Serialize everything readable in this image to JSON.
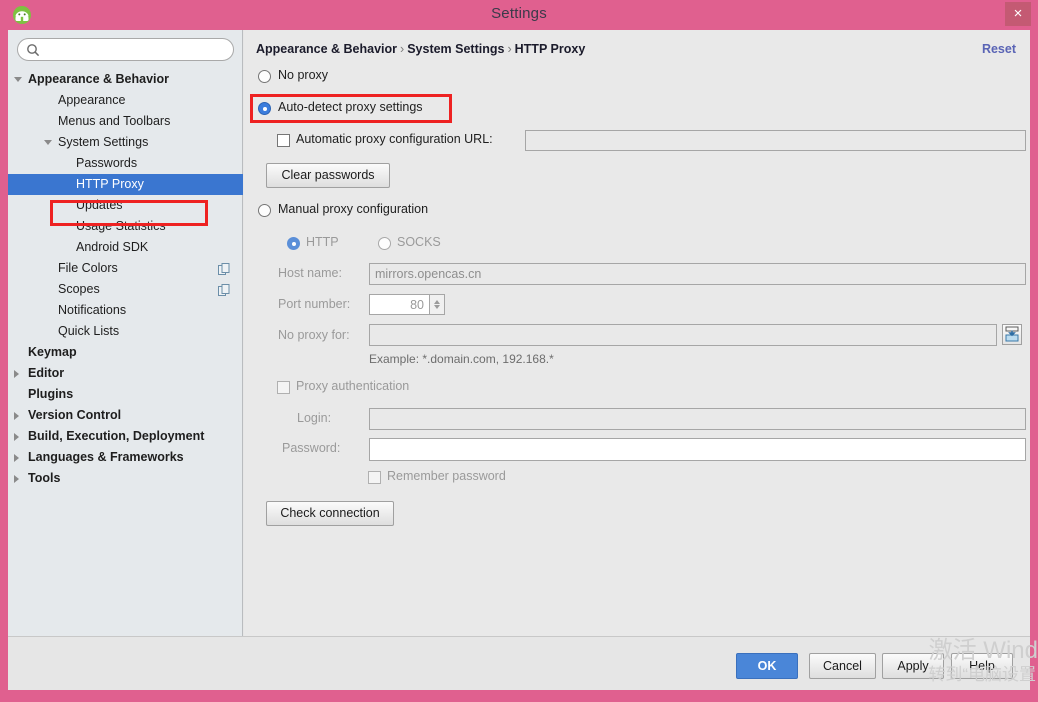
{
  "window": {
    "title": "Settings",
    "app_icon": "android-studio-icon",
    "close_label": "×",
    "accent_pink": "#e0608f",
    "selection_blue": "#3a76d0",
    "annotation_red": "#ee2222"
  },
  "search": {
    "placeholder": "",
    "value": "",
    "icon": "search-icon"
  },
  "sidebar": {
    "items": [
      {
        "label": "Appearance & Behavior",
        "indent": 20,
        "bold": true,
        "twisty": "open",
        "selected": false,
        "icon": null
      },
      {
        "label": "Appearance",
        "indent": 50,
        "bold": false,
        "twisty": null,
        "selected": false,
        "icon": null
      },
      {
        "label": "Menus and Toolbars",
        "indent": 50,
        "bold": false,
        "twisty": null,
        "selected": false,
        "icon": null
      },
      {
        "label": "System Settings",
        "indent": 50,
        "bold": false,
        "twisty": "open",
        "selected": false,
        "icon": null
      },
      {
        "label": "Passwords",
        "indent": 68,
        "bold": false,
        "twisty": null,
        "selected": false,
        "icon": null
      },
      {
        "label": "HTTP Proxy",
        "indent": 68,
        "bold": false,
        "twisty": null,
        "selected": true,
        "icon": null
      },
      {
        "label": "Updates",
        "indent": 68,
        "bold": false,
        "twisty": null,
        "selected": false,
        "icon": null
      },
      {
        "label": "Usage Statistics",
        "indent": 68,
        "bold": false,
        "twisty": null,
        "selected": false,
        "icon": null
      },
      {
        "label": "Android SDK",
        "indent": 68,
        "bold": false,
        "twisty": null,
        "selected": false,
        "icon": null
      },
      {
        "label": "File Colors",
        "indent": 50,
        "bold": false,
        "twisty": null,
        "selected": false,
        "icon": "copy-icon"
      },
      {
        "label": "Scopes",
        "indent": 50,
        "bold": false,
        "twisty": null,
        "selected": false,
        "icon": "copy-icon"
      },
      {
        "label": "Notifications",
        "indent": 50,
        "bold": false,
        "twisty": null,
        "selected": false,
        "icon": null
      },
      {
        "label": "Quick Lists",
        "indent": 50,
        "bold": false,
        "twisty": null,
        "selected": false,
        "icon": null
      },
      {
        "label": "Keymap",
        "indent": 20,
        "bold": true,
        "twisty": null,
        "selected": false,
        "icon": null
      },
      {
        "label": "Editor",
        "indent": 20,
        "bold": true,
        "twisty": "closed",
        "selected": false,
        "icon": null
      },
      {
        "label": "Plugins",
        "indent": 20,
        "bold": true,
        "twisty": null,
        "selected": false,
        "icon": null
      },
      {
        "label": "Version Control",
        "indent": 20,
        "bold": true,
        "twisty": "closed",
        "selected": false,
        "icon": null
      },
      {
        "label": "Build, Execution, Deployment",
        "indent": 20,
        "bold": true,
        "twisty": "closed",
        "selected": false,
        "icon": null
      },
      {
        "label": "Languages & Frameworks",
        "indent": 20,
        "bold": true,
        "twisty": "closed",
        "selected": false,
        "icon": null
      },
      {
        "label": "Tools",
        "indent": 20,
        "bold": true,
        "twisty": "closed",
        "selected": false,
        "icon": null
      }
    ]
  },
  "content": {
    "breadcrumb": [
      "Appearance & Behavior",
      "System Settings",
      "HTTP Proxy"
    ],
    "breadcrumb_separator": "›",
    "reset_label": "Reset",
    "options": {
      "no_proxy_label": "No proxy",
      "auto_detect_label": "Auto-detect proxy settings",
      "auto_config_url_label": "Automatic proxy configuration URL:",
      "auto_config_url_value": "",
      "clear_passwords_label": "Clear passwords",
      "manual_label": "Manual proxy configuration",
      "http_label": "HTTP",
      "socks_label": "SOCKS",
      "selected_mode": "auto-detect",
      "selected_protocol": "HTTP"
    },
    "manual": {
      "host_label": "Host name:",
      "host_value": "mirrors.opencas.cn",
      "port_label": "Port number:",
      "port_value": "80",
      "no_proxy_label": "No proxy for:",
      "no_proxy_value": "",
      "no_proxy_icon": "insert-expand-icon",
      "example_hint": "Example: *.domain.com, 192.168.*",
      "proxy_auth_label": "Proxy authentication",
      "login_label": "Login:",
      "login_value": "",
      "password_label": "Password:",
      "password_value": "",
      "remember_label": "Remember password",
      "check_connection_label": "Check connection"
    }
  },
  "footer": {
    "ok_label": "OK",
    "cancel_label": "Cancel",
    "apply_label": "Apply",
    "help_label": "Help"
  },
  "watermark": {
    "line1": "激活 Wind",
    "line2": "转到“电脑设置"
  }
}
